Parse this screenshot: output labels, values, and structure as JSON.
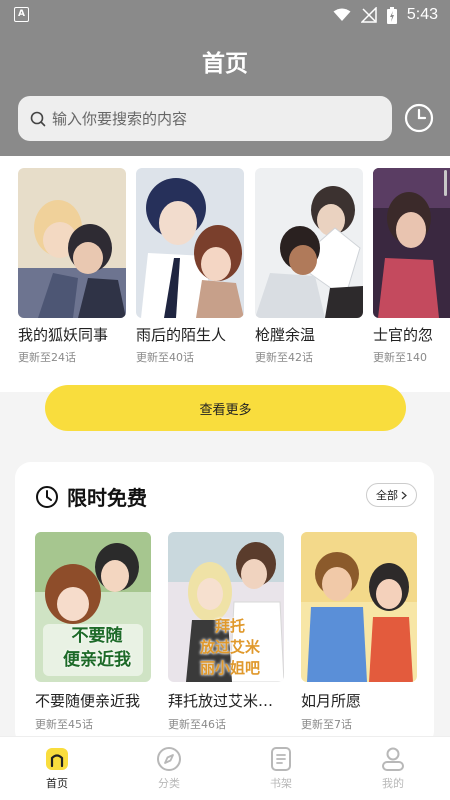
{
  "status_bar": {
    "time": "5:43",
    "app_icon_letter": "A"
  },
  "header": {
    "title": "首页"
  },
  "search": {
    "placeholder": "输入你要搜索的内容"
  },
  "carousel": {
    "items": [
      {
        "title": "我的狐妖同事",
        "subtitle": "更新至24话"
      },
      {
        "title": "雨后的陌生人",
        "subtitle": "更新至40话"
      },
      {
        "title": "枪膛余温",
        "subtitle": "更新至42话"
      },
      {
        "title": "士官的忽",
        "subtitle": "更新至140"
      }
    ]
  },
  "more_button": {
    "label": "查看更多"
  },
  "free_section": {
    "title": "限时免费",
    "all_label": "全部",
    "items": [
      {
        "title": "不要随便亲近我",
        "subtitle": "更新至45话",
        "cover_text": [
          "不要随",
          "便亲近我"
        ]
      },
      {
        "title": "拜托放过艾米…",
        "subtitle": "更新至46话",
        "cover_text": [
          "拜托",
          "放过艾米",
          "丽小姐吧"
        ]
      },
      {
        "title": "如月所愿",
        "subtitle": "更新至7话"
      }
    ]
  },
  "bottom_nav": {
    "items": [
      {
        "label": "首页",
        "icon": "home-icon",
        "active": true
      },
      {
        "label": "分类",
        "icon": "compass-icon",
        "active": false
      },
      {
        "label": "书架",
        "icon": "bookshelf-icon",
        "active": false
      },
      {
        "label": "我的",
        "icon": "profile-icon",
        "active": false
      }
    ]
  },
  "colors": {
    "accent": "#f9dd3d",
    "header_bg": "#8a8a8a",
    "inactive": "#b8b8b8",
    "active_text": "#222222"
  }
}
